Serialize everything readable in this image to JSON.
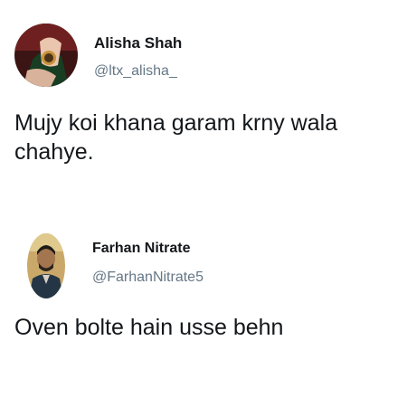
{
  "tweets": [
    {
      "name": "Alisha Shah",
      "handle": "@ltx_alisha_",
      "text": "Mujy koi khana garam krny wala chahye.",
      "avatar_icon": "profile-photo"
    },
    {
      "name": "Farhan Nitrate",
      "handle": "@FarhanNitrate5",
      "text": "Oven bolte hain usse behn",
      "avatar_icon": "profile-photo"
    }
  ],
  "colors": {
    "name": "#14171a",
    "handle": "#657786",
    "background": "#ffffff"
  }
}
